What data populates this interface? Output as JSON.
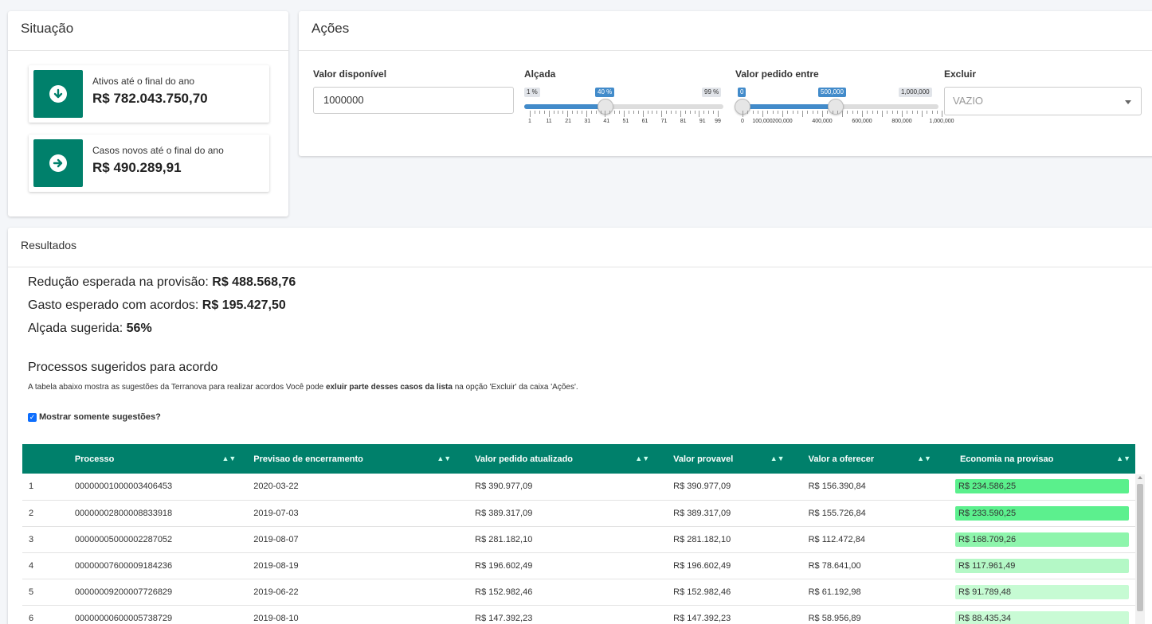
{
  "situacao": {
    "title": "Situação",
    "boxes": [
      {
        "label": "Ativos até o final do ano",
        "value": "R$ 782.043.750,70",
        "icon": "arrow-down-circle-icon"
      },
      {
        "label": "Casos novos até o final do ano",
        "value": "R$ 490.289,91",
        "icon": "arrow-right-circle-icon"
      }
    ]
  },
  "acoes": {
    "title": "Ações",
    "valor_disponivel": {
      "label": "Valor disponível",
      "value": "1000000"
    },
    "alcada": {
      "label": "Alçada",
      "min_label": "1 %",
      "max_label": "99 %",
      "value_label": "40 %",
      "min": 1,
      "max": 99,
      "value": 40,
      "ticks": [
        "1",
        "11",
        "21",
        "31",
        "41",
        "51",
        "61",
        "71",
        "81",
        "91",
        "99"
      ]
    },
    "valor_pedido": {
      "label": "Valor pedido entre",
      "min_label": "0",
      "max_label": "1,000,000",
      "from_label": "0",
      "to_label": "500,000",
      "min": 0,
      "max": 1000000,
      "from": 0,
      "to": 500000,
      "ticks": [
        "0",
        "100,000",
        "200,000",
        "400,000",
        "600,000",
        "800,000",
        "1,000,000"
      ]
    },
    "excluir": {
      "label": "Excluir",
      "value": "VAZIO"
    }
  },
  "resultados": {
    "title": "Resultados",
    "reducao_label": "Redução esperada na provisão:",
    "reducao_value": "R$ 488.568,76",
    "gasto_label": "Gasto esperado com acordos:",
    "gasto_value": "R$ 195.427,50",
    "alcada_label": "Alçada sugerida:",
    "alcada_value": "56%",
    "subtitle": "Processos sugeridos para acordo",
    "desc_pre": "A tabela abaixo mostra as sugestões da Terranova para realizar acordos Você pode ",
    "desc_bold": "exluir parte desses casos da lista",
    "desc_post": " na opção 'Excluir' da caixa 'Ações'.",
    "checkbox_label": "Mostrar somente sugestões?",
    "checkbox_checked": true
  },
  "table": {
    "headers": [
      "",
      "Processo",
      "Previsao de encerramento",
      "Valor pedido atualizado",
      "Valor provavel",
      "Valor a oferecer",
      "Economia na provisao"
    ],
    "rows": [
      {
        "n": "1",
        "processo": "00000001000003406453",
        "previsao": "2020-03-22",
        "pedido": "R$ 390.977,09",
        "provavel": "R$ 390.977,09",
        "oferecer": "R$ 156.390,84",
        "economia": "R$ 234.586,25",
        "color": "#5af08c"
      },
      {
        "n": "2",
        "processo": "00000002800008833918",
        "previsao": "2019-07-03",
        "pedido": "R$ 389.317,09",
        "provavel": "R$ 389.317,09",
        "oferecer": "R$ 155.726,84",
        "economia": "R$ 233.590,25",
        "color": "#5cf08e"
      },
      {
        "n": "3",
        "processo": "00000005000002287052",
        "previsao": "2019-08-07",
        "pedido": "R$ 281.182,10",
        "provavel": "R$ 281.182,10",
        "oferecer": "R$ 112.472,84",
        "economia": "R$ 168.709,26",
        "color": "#8ef5ac"
      },
      {
        "n": "4",
        "processo": "00000007600009184236",
        "previsao": "2019-08-19",
        "pedido": "R$ 196.602,49",
        "provavel": "R$ 196.602,49",
        "oferecer": "R$ 78.641,00",
        "economia": "R$ 117.961,49",
        "color": "#b4f8c6"
      },
      {
        "n": "5",
        "processo": "00000009200007726829",
        "previsao": "2019-06-22",
        "pedido": "R$ 152.982,46",
        "provavel": "R$ 152.982,46",
        "oferecer": "R$ 61.192,98",
        "economia": "R$ 91.789,48",
        "color": "#c6fbd3"
      },
      {
        "n": "6",
        "processo": "00000000600005738729",
        "previsao": "2019-08-10",
        "pedido": "R$ 147.392,23",
        "provavel": "R$ 147.392,23",
        "oferecer": "R$ 58.956,89",
        "economia": "R$ 88.435,34",
        "color": "#c9fbd5"
      }
    ]
  }
}
